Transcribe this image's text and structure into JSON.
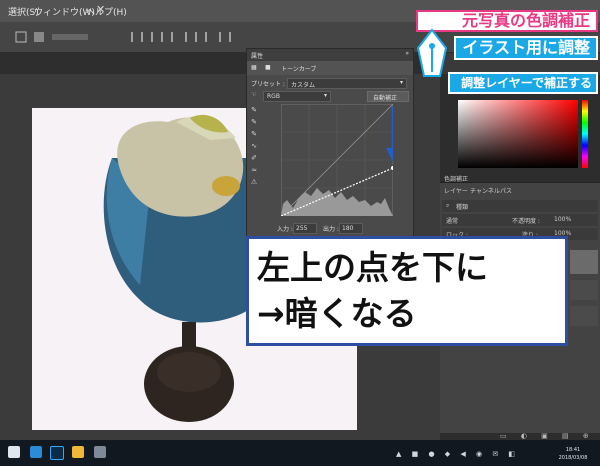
{
  "menubar": {
    "items": [
      "選択(S)",
      "ウィンドウ(W)",
      "ヘルプ(H)"
    ]
  },
  "curves": {
    "title": "属性",
    "tab": "トーンカーブ",
    "preset_label": "プリセット :",
    "preset_value": "カスタム",
    "channel": "RGB",
    "auto_button": "自動補正",
    "input_label": "入力 :",
    "input_value": "255",
    "output_label": "出力 :",
    "output_value": "180"
  },
  "right_panel": {
    "adjust_tab": "色調補正",
    "layers_tab": "レイヤー",
    "channels_tab": "チャンネル",
    "paths_tab": "パス",
    "kind_label": "種類",
    "blend_mode": "通常",
    "opacity_label": "不透明度 :",
    "opacity_value": "100%",
    "lock_label": "ロック :",
    "fill_label": "塗り :",
    "fill_value": "100%"
  },
  "taskbar": {
    "time": "18:41",
    "date": "2018/03/08"
  },
  "banner": {
    "line1": "元写真の色調補正",
    "line2": "イラスト用に調整",
    "line3": "調整レイヤーで補正する"
  },
  "callout": {
    "line1": "左上の点を下に",
    "line2": "→暗くなる"
  },
  "colors": {
    "pink": "#e83a84",
    "cyan": "#1aa9e6",
    "navy": "#2e4ea2",
    "arrow_blue": "#1f5fd0"
  }
}
